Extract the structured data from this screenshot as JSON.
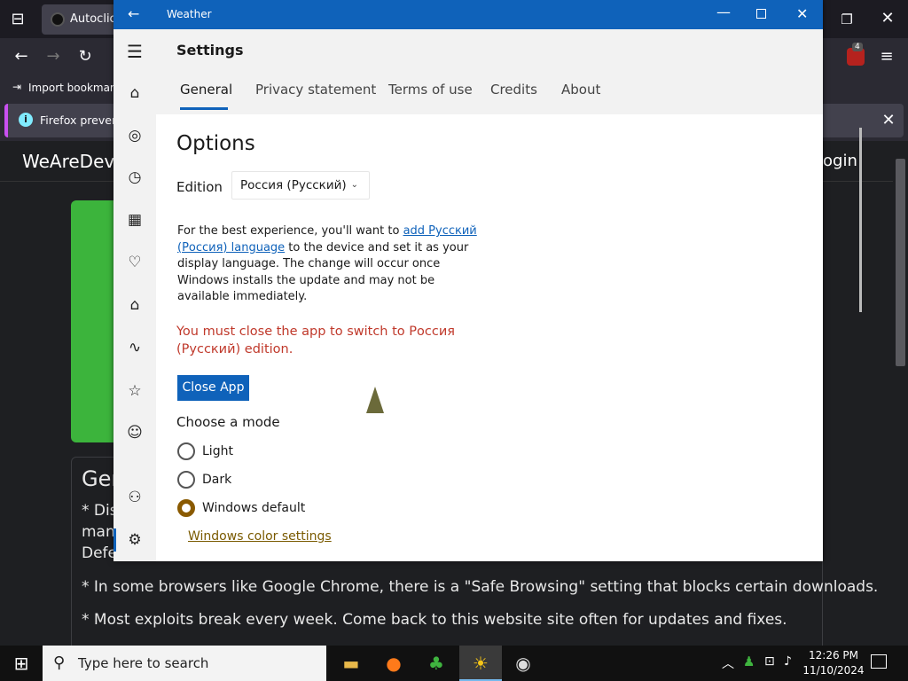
{
  "firefox": {
    "tab_title": "Autoclick",
    "bookmark_import": "Import bookmarks",
    "notification_text": "Firefox prevented",
    "site_header": "WeAreDev",
    "site_login": "ogin",
    "extension_badge": "4",
    "card": {
      "title": "Gen",
      "line1": "* Dis",
      "line2": "man",
      "line3": "Defe",
      "line4": "* In some browsers like Google Chrome, there is a \"Safe Browsing\" setting that blocks certain downloads.",
      "line5": "* Most exploits break every week. Come back to this website site often for updates and fixes."
    }
  },
  "weather": {
    "window_title": "Weather",
    "settings_title": "Settings",
    "tabs": [
      {
        "label": "General",
        "active": true
      },
      {
        "label": "Privacy statement"
      },
      {
        "label": "Terms of use"
      },
      {
        "label": "Credits"
      },
      {
        "label": "About"
      }
    ],
    "options_title": "Options",
    "edition_label": "Edition",
    "edition_value": "Россия (Русский)",
    "info_prefix": "For the best experience, you'll want to ",
    "info_link": "add Русский (Россия) language",
    "info_suffix": " to the device and set it as your display language. The change will occur once Windows installs the update and may not be available immediately.",
    "warning": "You must close the app to switch to Россия (Русский) edition.",
    "close_button": "Close App",
    "mode_label": "Choose a mode",
    "modes": [
      {
        "label": "Light",
        "selected": false
      },
      {
        "label": "Dark",
        "selected": false
      },
      {
        "label": "Windows default",
        "selected": true
      }
    ],
    "color_link": "Windows color settings"
  },
  "taskbar": {
    "search_placeholder": "Type here to search",
    "time": "12:26 PM",
    "date": "11/10/2024"
  },
  "colors": {
    "accent": "#0f62ba",
    "warning": "#c0392b",
    "radio_selected": "#8a5a00"
  }
}
